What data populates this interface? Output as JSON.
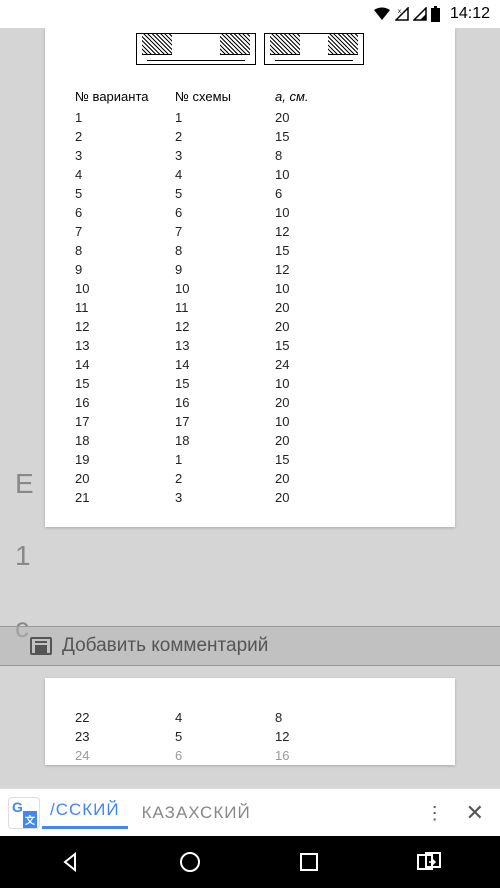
{
  "status": {
    "time": "14:12"
  },
  "bg_hints": [
    "Е",
    "1",
    "с"
  ],
  "table": {
    "headers": {
      "col1": "№ варианта",
      "col2": "№ схемы",
      "col3": "a, см."
    },
    "rows": [
      {
        "v": "1",
        "s": "1",
        "a": "20"
      },
      {
        "v": "2",
        "s": "2",
        "a": "15"
      },
      {
        "v": "3",
        "s": "3",
        "a": "8"
      },
      {
        "v": "4",
        "s": "4",
        "a": "10"
      },
      {
        "v": "5",
        "s": "5",
        "a": "6"
      },
      {
        "v": "6",
        "s": "6",
        "a": "10"
      },
      {
        "v": "7",
        "s": "7",
        "a": "12"
      },
      {
        "v": "8",
        "s": "8",
        "a": "15"
      },
      {
        "v": "9",
        "s": "9",
        "a": "12"
      },
      {
        "v": "10",
        "s": "10",
        "a": "10"
      },
      {
        "v": "11",
        "s": "11",
        "a": "20"
      },
      {
        "v": "12",
        "s": "12",
        "a": "20"
      },
      {
        "v": "13",
        "s": "13",
        "a": "15"
      },
      {
        "v": "14",
        "s": "14",
        "a": "24"
      },
      {
        "v": "15",
        "s": "15",
        "a": "10"
      },
      {
        "v": "16",
        "s": "16",
        "a": "20"
      },
      {
        "v": "17",
        "s": "17",
        "a": "10"
      },
      {
        "v": "18",
        "s": "18",
        "a": "20"
      },
      {
        "v": "19",
        "s": "1",
        "a": "15"
      },
      {
        "v": "20",
        "s": "2",
        "a": "20"
      },
      {
        "v": "21",
        "s": "3",
        "a": "20"
      }
    ]
  },
  "table2": {
    "rows": [
      {
        "v": "22",
        "s": "4",
        "a": "8"
      },
      {
        "v": "23",
        "s": "5",
        "a": "12"
      },
      {
        "v": "24",
        "s": "6",
        "a": "16"
      }
    ]
  },
  "comment": {
    "label": "Добавить комментарий"
  },
  "translate": {
    "lang_active": "/ССКИЙ",
    "lang_other": "КАЗАХСКИЙ"
  }
}
